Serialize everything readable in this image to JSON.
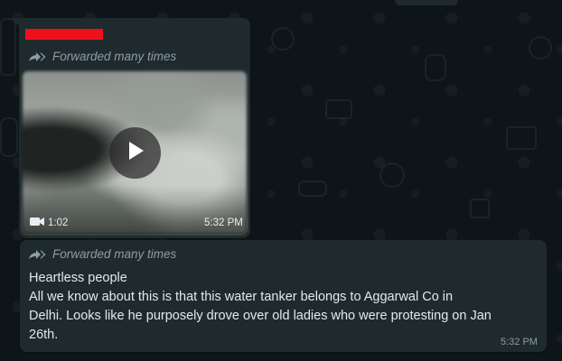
{
  "colors": {
    "wallpaper": "#0e1518",
    "bubble": "#1f2a2f",
    "redaction": "#f0101a",
    "meta_text": "#8f9ca3",
    "message_text": "#e4e8ea"
  },
  "message_1": {
    "sender_redacted": true,
    "forwarded_label": "Forwarded many times",
    "forwarded_icon": "forward-double-arrow-icon",
    "video": {
      "play_icon": "play-icon",
      "camera_icon": "video-camera-icon",
      "duration": "1:02",
      "time": "5:32 PM"
    }
  },
  "message_2": {
    "forwarded_label": "Forwarded many times",
    "forwarded_icon": "forward-double-arrow-icon",
    "lines": [
      "Heartless people",
      "All we know about this is that this water tanker belongs to Aggarwal Co in",
      "Delhi. Looks like he purposely drove over old ladies who were protesting on Jan",
      "26th."
    ],
    "time": "5:32 PM"
  }
}
